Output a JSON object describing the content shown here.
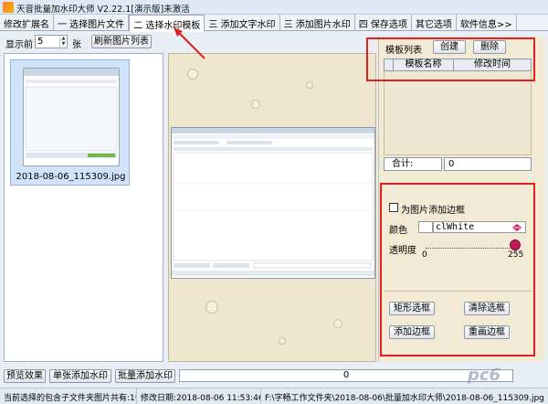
{
  "window": {
    "title": "天音批量加水印大师 V2.22.1[演示版]未激活"
  },
  "tabs": [
    {
      "label": "修改扩展名",
      "active": false
    },
    {
      "label": "一 选择图片文件",
      "active": false
    },
    {
      "label": "二 选择水印模板",
      "active": true
    },
    {
      "label": "三 添加文字水印",
      "active": false
    },
    {
      "label": "三 添加图片水印",
      "active": false
    },
    {
      "label": "四 保存选项",
      "active": false
    },
    {
      "label": "其它选项",
      "active": false
    },
    {
      "label": "软件信息>>",
      "active": false
    }
  ],
  "toolbar": {
    "show_prefix": "显示前",
    "show_count": "5",
    "show_suffix": "张",
    "refresh_label": "刷新图片列表"
  },
  "thumbnails": [
    {
      "caption": "2018-08-06_115309.jpg"
    }
  ],
  "templates": {
    "title": "模板列表",
    "create_label": "创建",
    "delete_label": "删除",
    "columns": [
      "模板名称",
      "修改时间"
    ],
    "total_label": "合计:",
    "total_value": "0"
  },
  "border": {
    "add_border_label": "为图片添加边框",
    "add_border_checked": false,
    "color_label": "颜色",
    "color_value": "clWhite",
    "opacity_label": "透明度",
    "opacity_min": "0",
    "opacity_max": "255",
    "opacity_value": 255,
    "rect_select_label": "矩形选框",
    "clear_select_label": "清除选框",
    "add_border_btn": "添加边框",
    "redraw_border_btn": "重画边框"
  },
  "actions": {
    "preview_label": "预览效果",
    "single_label": "单张添加水印",
    "batch_label": "批量添加水印",
    "progress_text": "0",
    "progress_value": 0
  },
  "status": {
    "count_text": "当前选择的包含子文件夹图片共有:1张",
    "modified_text": "修改日期:2018-08-06 11:53:46",
    "path_text": "F:\\字畅工作文件夹\\2018-08-06\\批量加水印大师\\2018-08-06_115309.jpg"
  },
  "watermark_text": "pc6",
  "colors": {
    "highlight_box": "#e02020",
    "canvas_bg": "#efe6cf",
    "opacity_knob": "#c2185b"
  }
}
